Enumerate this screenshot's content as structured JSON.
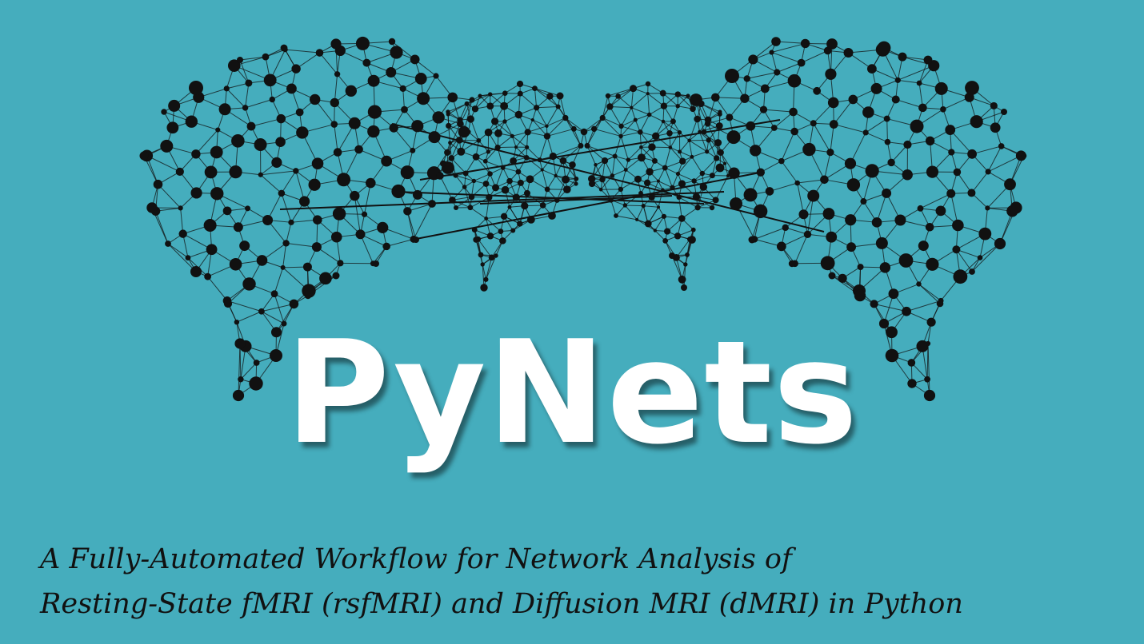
{
  "background_color": "#45adbd",
  "network_color": "#111111",
  "title": "PyNets",
  "subtitle": {
    "line1": "A Fully-Automated Workflow for Network Analysis of",
    "line2": "Resting-State fMRI (rsfMRI) and Diffusion MRI (dMRI) in Python"
  },
  "graphic": {
    "icon": "brain-network-graph"
  }
}
